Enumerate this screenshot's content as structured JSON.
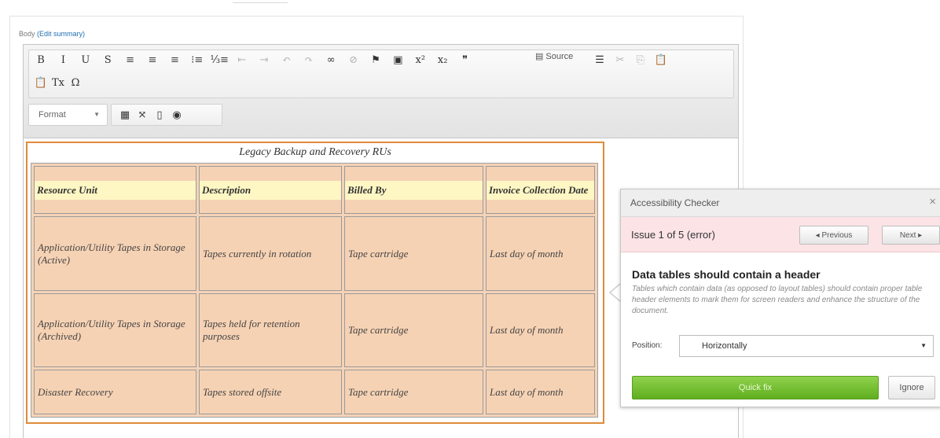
{
  "field": {
    "label": "Body",
    "edit_summary": "(Edit summary)"
  },
  "toolbar": {
    "row1": [
      {
        "name": "bold-icon",
        "glyph": "B"
      },
      {
        "name": "italic-icon",
        "glyph": "I"
      },
      {
        "name": "underline-icon",
        "glyph": "U"
      },
      {
        "name": "strikethrough-icon",
        "glyph": "S"
      },
      {
        "name": "align-left-icon",
        "glyph": "≡"
      },
      {
        "name": "align-center-icon",
        "glyph": "≡"
      },
      {
        "name": "align-right-icon",
        "glyph": "≡"
      },
      {
        "name": "bulleted-list-icon",
        "glyph": "⁝≡"
      },
      {
        "name": "numbered-list-icon",
        "glyph": "⅓≡"
      },
      {
        "name": "outdent-icon",
        "glyph": "⇤"
      },
      {
        "name": "indent-icon",
        "glyph": "⇥"
      },
      {
        "name": "undo-icon",
        "glyph": "↶"
      },
      {
        "name": "redo-icon",
        "glyph": "↷"
      },
      {
        "name": "link-icon",
        "glyph": "∞"
      },
      {
        "name": "unlink-icon",
        "glyph": "⊘"
      },
      {
        "name": "anchor-flag-icon",
        "glyph": "⚑"
      },
      {
        "name": "image-icon",
        "glyph": "▣"
      },
      {
        "name": "superscript-icon",
        "glyph": "x²"
      },
      {
        "name": "subscript-icon",
        "glyph": "x₂"
      },
      {
        "name": "blockquote-icon",
        "glyph": "❞"
      }
    ],
    "source_label": "Source",
    "row1b": [
      {
        "name": "horizontal-rule-icon",
        "glyph": "☰"
      },
      {
        "name": "cut-icon",
        "glyph": "✂"
      },
      {
        "name": "copy-icon",
        "glyph": "⎘"
      },
      {
        "name": "paste-icon",
        "glyph": "📋"
      }
    ],
    "row2": [
      {
        "name": "paste-text-icon",
        "glyph": "📋"
      },
      {
        "name": "remove-format-icon",
        "glyph": "Tx"
      },
      {
        "name": "special-char-icon",
        "glyph": "Ω"
      }
    ],
    "format_label": "Format",
    "row3": [
      {
        "name": "table-icon",
        "glyph": "▦"
      },
      {
        "name": "maximize-icon",
        "glyph": "⤧"
      },
      {
        "name": "show-blocks-icon",
        "glyph": "▯"
      },
      {
        "name": "accessibility-checker-icon",
        "glyph": "◉"
      }
    ]
  },
  "table": {
    "caption": "Legacy Backup and Recovery RUs",
    "headers": [
      "Resource Unit",
      "Description",
      "Billed By",
      "Invoice Collection Date"
    ],
    "rows": [
      [
        "Application/Utility Tapes in Storage (Active)",
        "Tapes currently in rotation",
        "Tape cartridge",
        "Last day of month"
      ],
      [
        "Application/Utility Tapes in Storage (Archived)",
        "Tapes held for retention purposes",
        "Tape cartridge",
        "Last day of month"
      ],
      [
        "Disaster Recovery",
        "Tapes stored offsite",
        "Tape cartridge",
        "Last day of month"
      ]
    ]
  },
  "checker": {
    "title": "Accessibility Checker",
    "close": "×",
    "issue_counter": "Issue 1 of 5 (error)",
    "previous_label": "◂ Previous",
    "next_label": "Next ▸",
    "issue_title": "Data tables should contain a header",
    "issue_description": "Tables which contain data (as opposed to layout tables) should contain proper table header elements to mark them for screen readers and enhance the structure of the document.",
    "position_label": "Position:",
    "position_value": "Horizontally",
    "quickfix_label": "Quick fix",
    "ignore_label": "Ignore"
  }
}
